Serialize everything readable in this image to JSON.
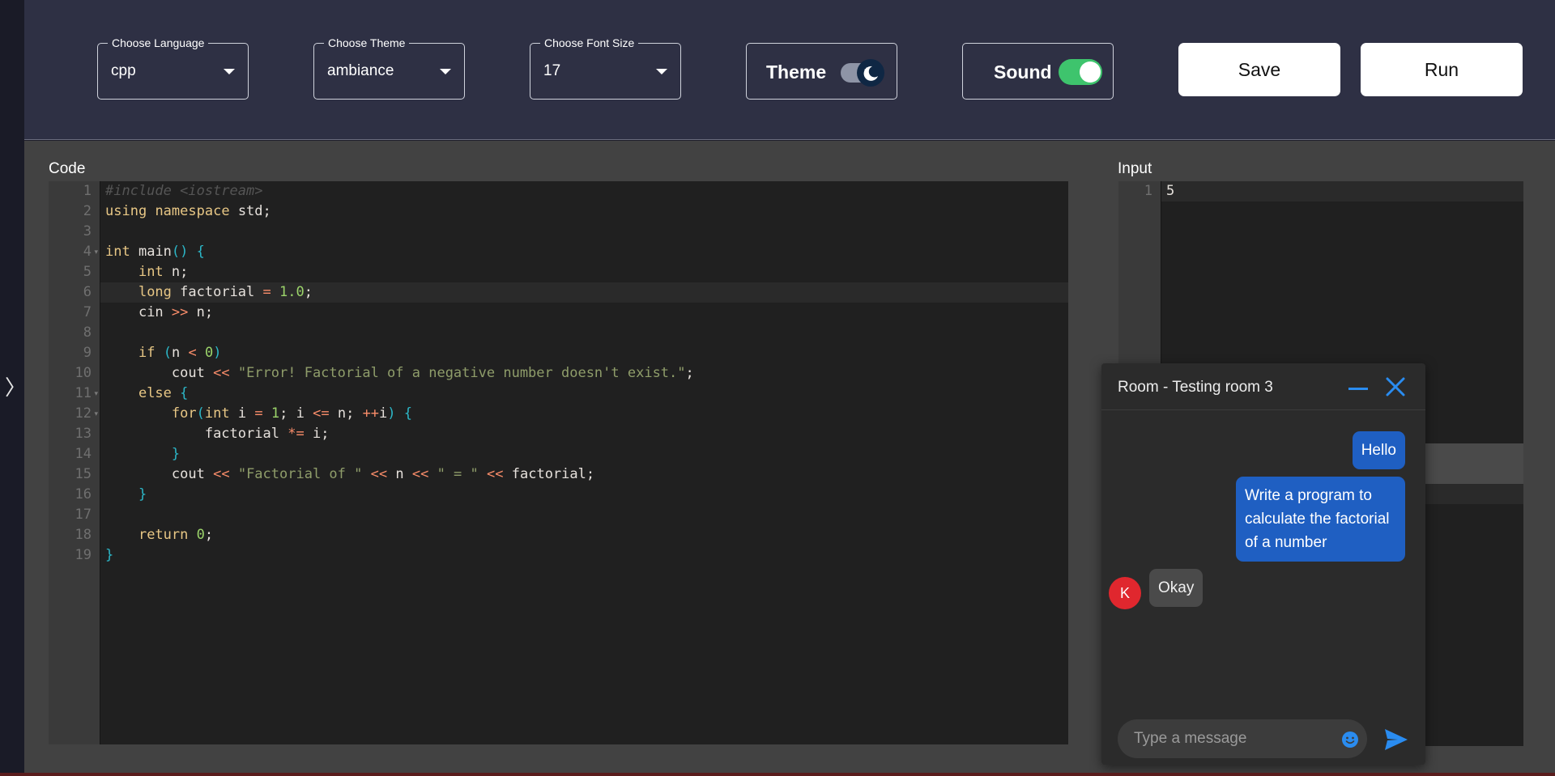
{
  "toolbar": {
    "language": {
      "legend": "Choose Language",
      "value": "cpp"
    },
    "theme_select": {
      "legend": "Choose Theme",
      "value": "ambiance"
    },
    "font_size": {
      "legend": "Choose Font Size",
      "value": "17"
    },
    "theme_toggle": {
      "label": "Theme",
      "enabled": true
    },
    "sound_toggle": {
      "label": "Sound",
      "enabled": true
    },
    "save_label": "Save",
    "run_label": "Run"
  },
  "editor": {
    "label": "Code",
    "line_numbers": [
      "1",
      "2",
      "3",
      "4",
      "5",
      "6",
      "7",
      "8",
      "9",
      "10",
      "11",
      "12",
      "13",
      "14",
      "15",
      "16",
      "17",
      "18",
      "19"
    ],
    "foldable_lines": [
      4,
      11,
      12
    ],
    "lines": [
      "#include <iostream>",
      "using namespace std;",
      "",
      "int main() {",
      "    int n;",
      "    long factorial = 1.0;",
      "    cin >> n;",
      "",
      "    if (n < 0)",
      "        cout << \"Error! Factorial of a negative number doesn't exist.\";",
      "    else {",
      "        for(int i = 1; i <= n; ++i) {",
      "            factorial *= i;",
      "        }",
      "        cout << \"Factorial of \" << n << \" = \" << factorial;",
      "    }",
      "",
      "    return 0;",
      "}"
    ]
  },
  "input": {
    "label": "Input",
    "line_numbers": [
      "1"
    ],
    "lines": [
      "5"
    ]
  },
  "chat": {
    "title": "Room - Testing room 3",
    "messages": [
      {
        "from": "me",
        "text": "Hello"
      },
      {
        "from": "me",
        "text": "Write a program to calculate the factorial of a number"
      },
      {
        "from": "K",
        "text": "Okay"
      }
    ],
    "avatar_initial": "K",
    "placeholder": "Type a message"
  },
  "colors": {
    "toolbar_bg": "#2e3044",
    "accent_blue": "#2a8cf0",
    "sound_on": "#3ec46d",
    "avatar_red": "#e0272e"
  }
}
